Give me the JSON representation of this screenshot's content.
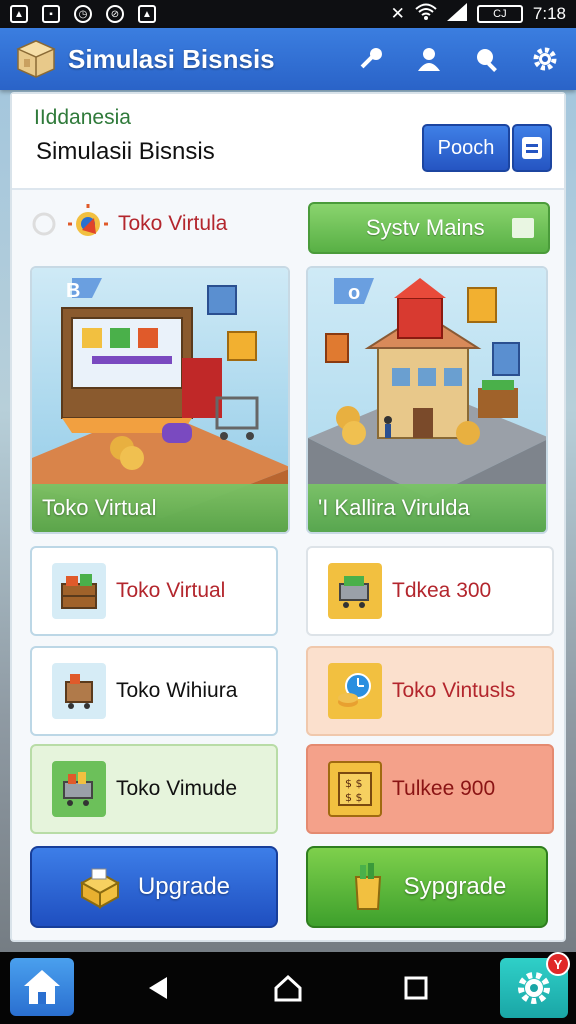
{
  "status_bar": {
    "time": "7:18",
    "battery": "CJ"
  },
  "app_bar": {
    "title": "Simulasi Bisnsis"
  },
  "header": {
    "small_label": "IIddanesia",
    "title": "Simulasii Bisnsis",
    "pooch_button": "Pooch"
  },
  "row1": {
    "label": "Toko Virtula",
    "green_button": "Systv Mains"
  },
  "cards": [
    {
      "badge": "B",
      "label": "Toko Virtual"
    },
    {
      "badge": "o",
      "label": "'I  Kallira Virulda"
    }
  ],
  "tiles": [
    {
      "label": "Toko Virtual"
    },
    {
      "label": "Tdkea 300"
    },
    {
      "label": "Toko Wihiura"
    },
    {
      "label": "Toko Vintusls"
    },
    {
      "label": "Toko Vimude"
    },
    {
      "label": "Tulkee 900"
    }
  ],
  "buttons": {
    "upgrade": "Upgrade",
    "sypgrade": "Sypgrade"
  },
  "nav": {
    "badge": "Y"
  },
  "colors": {
    "appbar": "#2a63c8",
    "green": "#58b045",
    "red": "#b3262d"
  }
}
